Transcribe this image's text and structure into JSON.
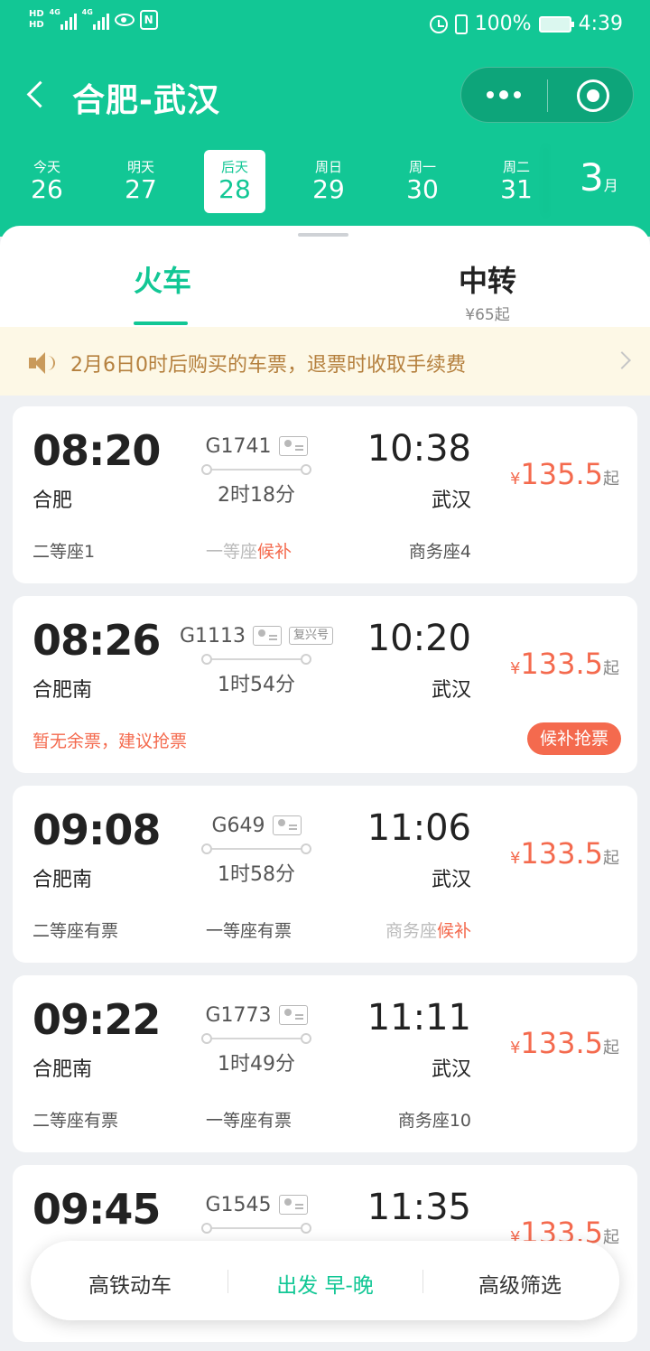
{
  "status_bar": {
    "hd1": "HD",
    "hd2": "HD",
    "net1": "4G",
    "net2": "4G",
    "battery_pct": "100%",
    "time": "4:39"
  },
  "header": {
    "title": "合肥-武汉",
    "colors": {
      "primary": "#12c795",
      "accent": "#f46a4e"
    }
  },
  "dates": [
    {
      "weekday": "今天",
      "day": "26"
    },
    {
      "weekday": "明天",
      "day": "27"
    },
    {
      "weekday": "后天",
      "day": "28",
      "selected": true
    },
    {
      "weekday": "周日",
      "day": "29"
    },
    {
      "weekday": "周一",
      "day": "30"
    },
    {
      "weekday": "周二",
      "day": "31"
    }
  ],
  "month": {
    "num": "3",
    "unit": "月"
  },
  "tabs": {
    "train": "火车",
    "transfer": "中转",
    "transfer_price": "¥65起"
  },
  "notice": {
    "text": "2月6日0时后购买的车票，退票时收取手续费"
  },
  "trains": [
    {
      "dep_time": "08:20",
      "dep_station": "合肥",
      "train_no": "G1741",
      "duration": "2时18分",
      "arr_time": "10:38",
      "arr_station": "武汉",
      "price_symbol": "¥",
      "price": "135.5",
      "price_suffix": "起",
      "seat1": "二等座1",
      "seat2_label": "一等座",
      "seat2_status": "候补",
      "seat3": "商务座4"
    },
    {
      "dep_time": "08:26",
      "dep_station": "合肥南",
      "train_no": "G1113",
      "badge": "复兴号",
      "duration": "1时54分",
      "arr_time": "10:20",
      "arr_station": "武汉",
      "price_symbol": "¥",
      "price": "133.5",
      "price_suffix": "起",
      "soldout_text": "暂无余票，建议抢票",
      "wait_button": "候补抢票"
    },
    {
      "dep_time": "09:08",
      "dep_station": "合肥南",
      "train_no": "G649",
      "duration": "1时58分",
      "arr_time": "11:06",
      "arr_station": "武汉",
      "price_symbol": "¥",
      "price": "133.5",
      "price_suffix": "起",
      "seat1": "二等座有票",
      "seat2": "一等座有票",
      "seat3_label": "商务座",
      "seat3_status": "候补"
    },
    {
      "dep_time": "09:22",
      "dep_station": "合肥南",
      "train_no": "G1773",
      "duration": "1时49分",
      "arr_time": "11:11",
      "arr_station": "武汉",
      "price_symbol": "¥",
      "price": "133.5",
      "price_suffix": "起",
      "seat1": "二等座有票",
      "seat2": "一等座有票",
      "seat3": "商务座10"
    },
    {
      "dep_time": "09:45",
      "train_no": "G1545",
      "arr_time": "11:35",
      "price_symbol": "¥",
      "price": "133.5",
      "price_suffix": "起"
    }
  ],
  "filters": {
    "type": "高铁动车",
    "time": "出发 早-晚",
    "advanced": "高级筛选"
  }
}
